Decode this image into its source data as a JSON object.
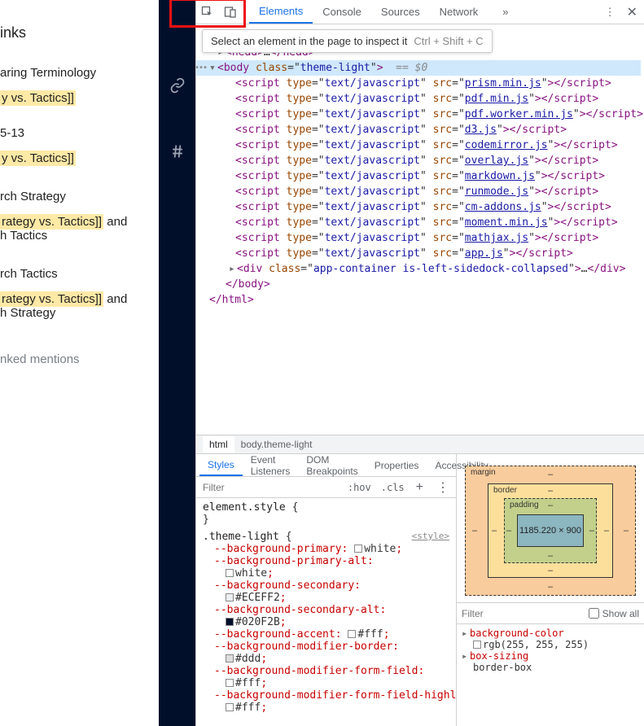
{
  "left": {
    "h1": "inks",
    "h2": "aring Terminology",
    "item1": "y vs. Tactics]]",
    "date": "5-13",
    "item2": "y vs. Tactics]]",
    "hs": "rch Strategy",
    "para_s1": "rategy vs. Tactics]]",
    "para_s2": " and",
    "para_s3": "h Tactics",
    "ht": "rch Tactics",
    "para_t1": "rategy vs. Tactics]]",
    "para_t2": " and",
    "para_t3": "h Strategy",
    "muted": "nked mentions"
  },
  "tooltip": {
    "text": "Select an element in the page to inspect it",
    "kbd": "Ctrl + Shift + C"
  },
  "tabs": {
    "elements": "Elements",
    "console": "Console",
    "sources": "Sources",
    "network": "Network",
    "more": "»"
  },
  "dom": {
    "html_open": "html",
    "head": "head",
    "body_tag": "body",
    "body_class_attr": "class",
    "body_class_val": "theme-light",
    "sel_hint": "== $0",
    "scripts": [
      "prism.min.js",
      "pdf.min.js",
      "pdf.worker.min.js",
      "d3.js",
      "codemirror.js",
      "overlay.js",
      "markdown.js",
      "runmode.js",
      "cm-addons.js",
      "moment.min.js",
      "mathjax.js",
      "app.js"
    ],
    "attr_type": "type",
    "attr_type_val": "text/javascript",
    "attr_src": "src",
    "div_class_val": "app-container is-left-sidedock-collapsed"
  },
  "breadcrumb": {
    "a": "html",
    "b": "body.theme-light"
  },
  "subtabs": {
    "styles": "Styles",
    "ev": "Event Listeners",
    "dom": "DOM Breakpoints",
    "prop": "Properties",
    "acc": "Accessibility"
  },
  "filter": {
    "ph": "Filter",
    "hov": ":hov",
    "cls": ".cls"
  },
  "styles": {
    "elstyle_sel": "element.style",
    "brace_o": " {",
    "brace_c": "}",
    "theme_sel": ".theme-light",
    "origin": "<style>",
    "props": [
      {
        "n": "--background-primary",
        "v": "white",
        "sw": "#ffffff"
      },
      {
        "n": "--background-primary-alt",
        "v": "white",
        "sw": "#ffffff",
        "wrap": true
      },
      {
        "n": "--background-secondary",
        "v": "#ECEFF2",
        "sw": "#ECEFF2",
        "wrap": true
      },
      {
        "n": "--background-secondary-alt",
        "v": "#020F2B",
        "sw": "#020F2B",
        "wrap": true
      },
      {
        "n": "--background-accent",
        "v": "#fff",
        "sw": "#ffffff"
      },
      {
        "n": "--background-modifier-border",
        "v": "#ddd",
        "sw": "#dddddd",
        "wrap": true
      },
      {
        "n": "--background-modifier-form-field",
        "v": "#fff",
        "sw": "#ffffff",
        "wrap": true
      },
      {
        "n": "--background-modifier-form-field-highlighted",
        "v": "#fff",
        "sw": "#ffffff",
        "wrap": true
      }
    ]
  },
  "boxmodel": {
    "margin": "margin",
    "border": "border",
    "padding": "padding",
    "content": "1185.220 × 900",
    "dash": "–"
  },
  "computed": {
    "filter_ph": "Filter",
    "showall": "Show all",
    "items": [
      {
        "n": "background-color",
        "v": "rgb(255, 255, 255)",
        "sw": "#ffffff"
      },
      {
        "n": "box-sizing",
        "v": "border-box"
      }
    ]
  }
}
